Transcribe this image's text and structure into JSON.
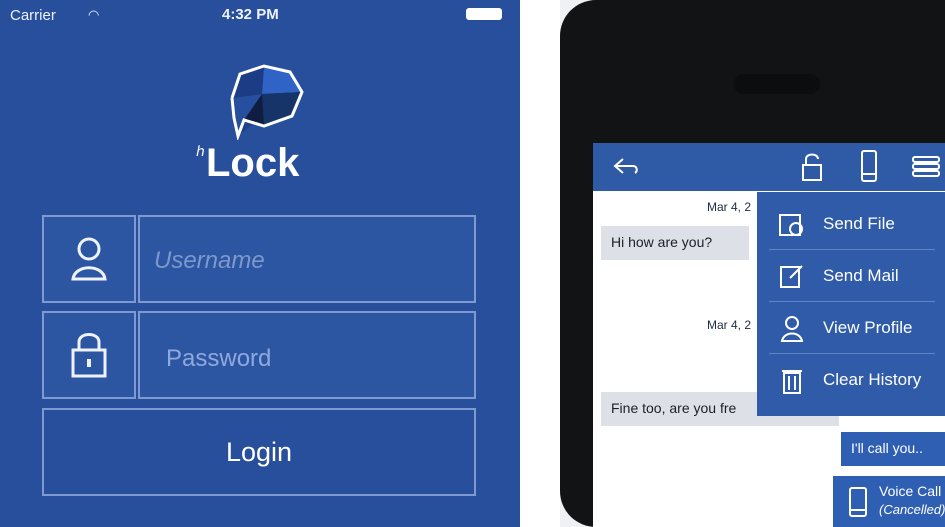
{
  "left": {
    "status": {
      "carrier": "Carrier",
      "time": "4:32 PM"
    },
    "brand": {
      "prefix": "ℎ",
      "name": "Lock"
    },
    "fields": {
      "username_placeholder": "Username",
      "password_placeholder": "Password"
    },
    "login_label": "Login"
  },
  "right": {
    "chat": {
      "date_1": "Mar 4, 2",
      "msg_1": "Hi how are you?",
      "date_2": "Mar 4, 2",
      "msg_2": "Fine too, are you fre",
      "msg_3": "I'll call you..",
      "voice_call": {
        "title": "Voice Call",
        "status": "(Cancelled)"
      }
    },
    "menu": [
      {
        "label": "Send File",
        "icon": "send-file-icon"
      },
      {
        "label": "Send Mail",
        "icon": "send-mail-icon"
      },
      {
        "label": "View Profile",
        "icon": "view-profile-icon"
      },
      {
        "label": "Clear History",
        "icon": "clear-history-icon"
      }
    ]
  },
  "colors": {
    "primary": "#284f9b",
    "accent": "#2f5ba9"
  }
}
